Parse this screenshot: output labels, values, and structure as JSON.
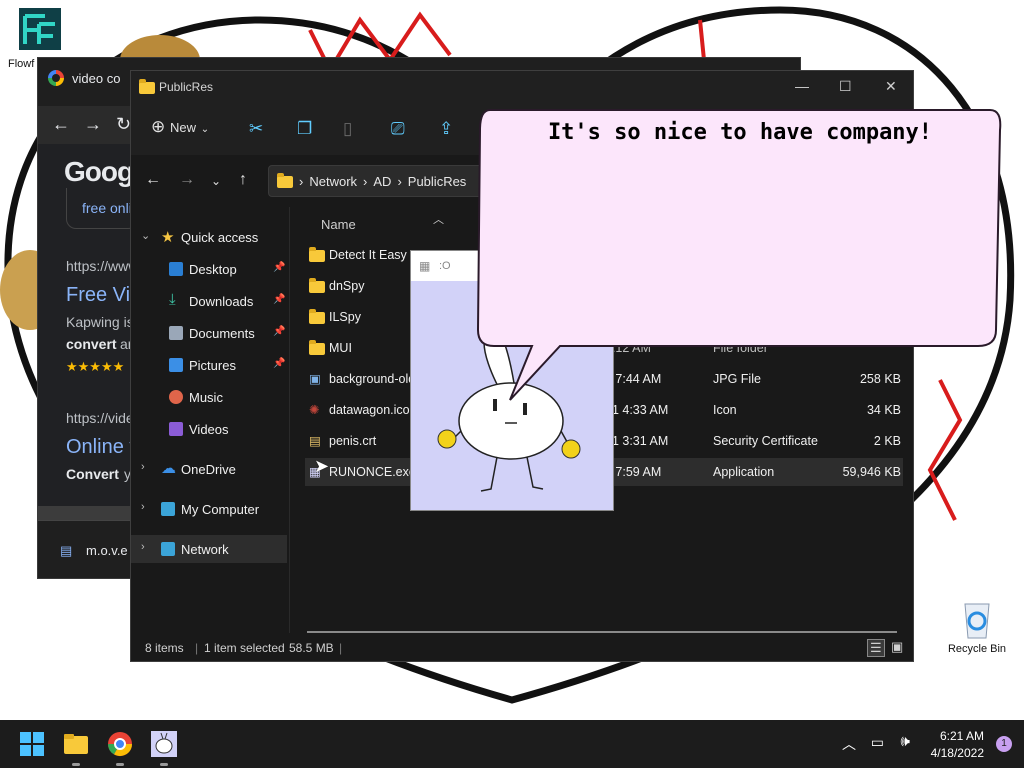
{
  "desktop": {
    "top_icon_label": "Flowf",
    "recycle_bin_label": "Recycle Bin"
  },
  "chrome": {
    "tab_title": "video co",
    "logo": "Goog",
    "chip_text": "free onli",
    "results": [
      {
        "url": "https://www",
        "title": "Free Vi",
        "snippet1": "Kapwing is",
        "snippet_bold": "convert",
        "snippet_rest": "an",
        "stars": "★★★★★"
      },
      {
        "url": "https://vide",
        "title": "Online v",
        "snippet_bold": "Convert",
        "snippet_rest": "yc"
      }
    ],
    "download_name": "m.o.v.e"
  },
  "explorer": {
    "title": "PublicRes",
    "new_label": "New",
    "address": [
      "Network",
      "AD",
      "PublicRes"
    ],
    "column_name": "Name",
    "sidebar": [
      {
        "label": "Quick access",
        "icon": "star-icon",
        "type": "group"
      },
      {
        "label": "Desktop",
        "icon": "desktop-icon",
        "pinned": true
      },
      {
        "label": "Downloads",
        "icon": "download-icon",
        "pinned": true
      },
      {
        "label": "Documents",
        "icon": "document-icon",
        "pinned": true
      },
      {
        "label": "Pictures",
        "icon": "picture-icon",
        "pinned": true
      },
      {
        "label": "Music",
        "icon": "music-icon"
      },
      {
        "label": "Videos",
        "icon": "video-icon"
      },
      {
        "label": "OneDrive",
        "icon": "cloud-icon",
        "type": "group"
      },
      {
        "label": "My Computer",
        "icon": "computer-icon",
        "type": "group"
      },
      {
        "label": "Network",
        "icon": "network-icon",
        "type": "group",
        "selected": true
      }
    ],
    "files": [
      {
        "name": "Detect It Easy",
        "icon": "folder-icon",
        "date": "",
        "type": "",
        "size": ""
      },
      {
        "name": "dnSpy",
        "icon": "folder-icon",
        "date": "",
        "type": "",
        "size": ""
      },
      {
        "name": "ILSpy",
        "icon": "folder-icon",
        "date": "",
        "type": "",
        "size": ""
      },
      {
        "name": "MUI",
        "icon": "folder-icon",
        "date": "7:12 AM",
        "type": "File folder",
        "size": ""
      },
      {
        "name": "background-old",
        "icon": "image-file-icon",
        "date": "1 7:44 AM",
        "type": "JPG File",
        "size": "258 KB"
      },
      {
        "name": "datawagon.ico",
        "icon": "ico-file-icon",
        "date": "21 4:33 AM",
        "type": "Icon",
        "size": "34 KB"
      },
      {
        "name": "penis.crt",
        "icon": "certificate-icon",
        "date": "21 3:31 AM",
        "type": "Security Certificate",
        "size": "2 KB"
      },
      {
        "name": "RUNONCE.exe",
        "icon": "exe-icon",
        "date": "2 7:59 AM",
        "type": "Application",
        "size": "59,946 KB",
        "selected": true
      }
    ],
    "status": {
      "count": "8 items",
      "selected": "1 item selected",
      "size": "58.5 MB"
    }
  },
  "popup": {
    "title": ":O"
  },
  "speech_bubble": {
    "text": "It's so nice to have company!"
  },
  "taskbar": {
    "time": "6:21 AM",
    "date": "4/18/2022",
    "notification_count": "1"
  }
}
